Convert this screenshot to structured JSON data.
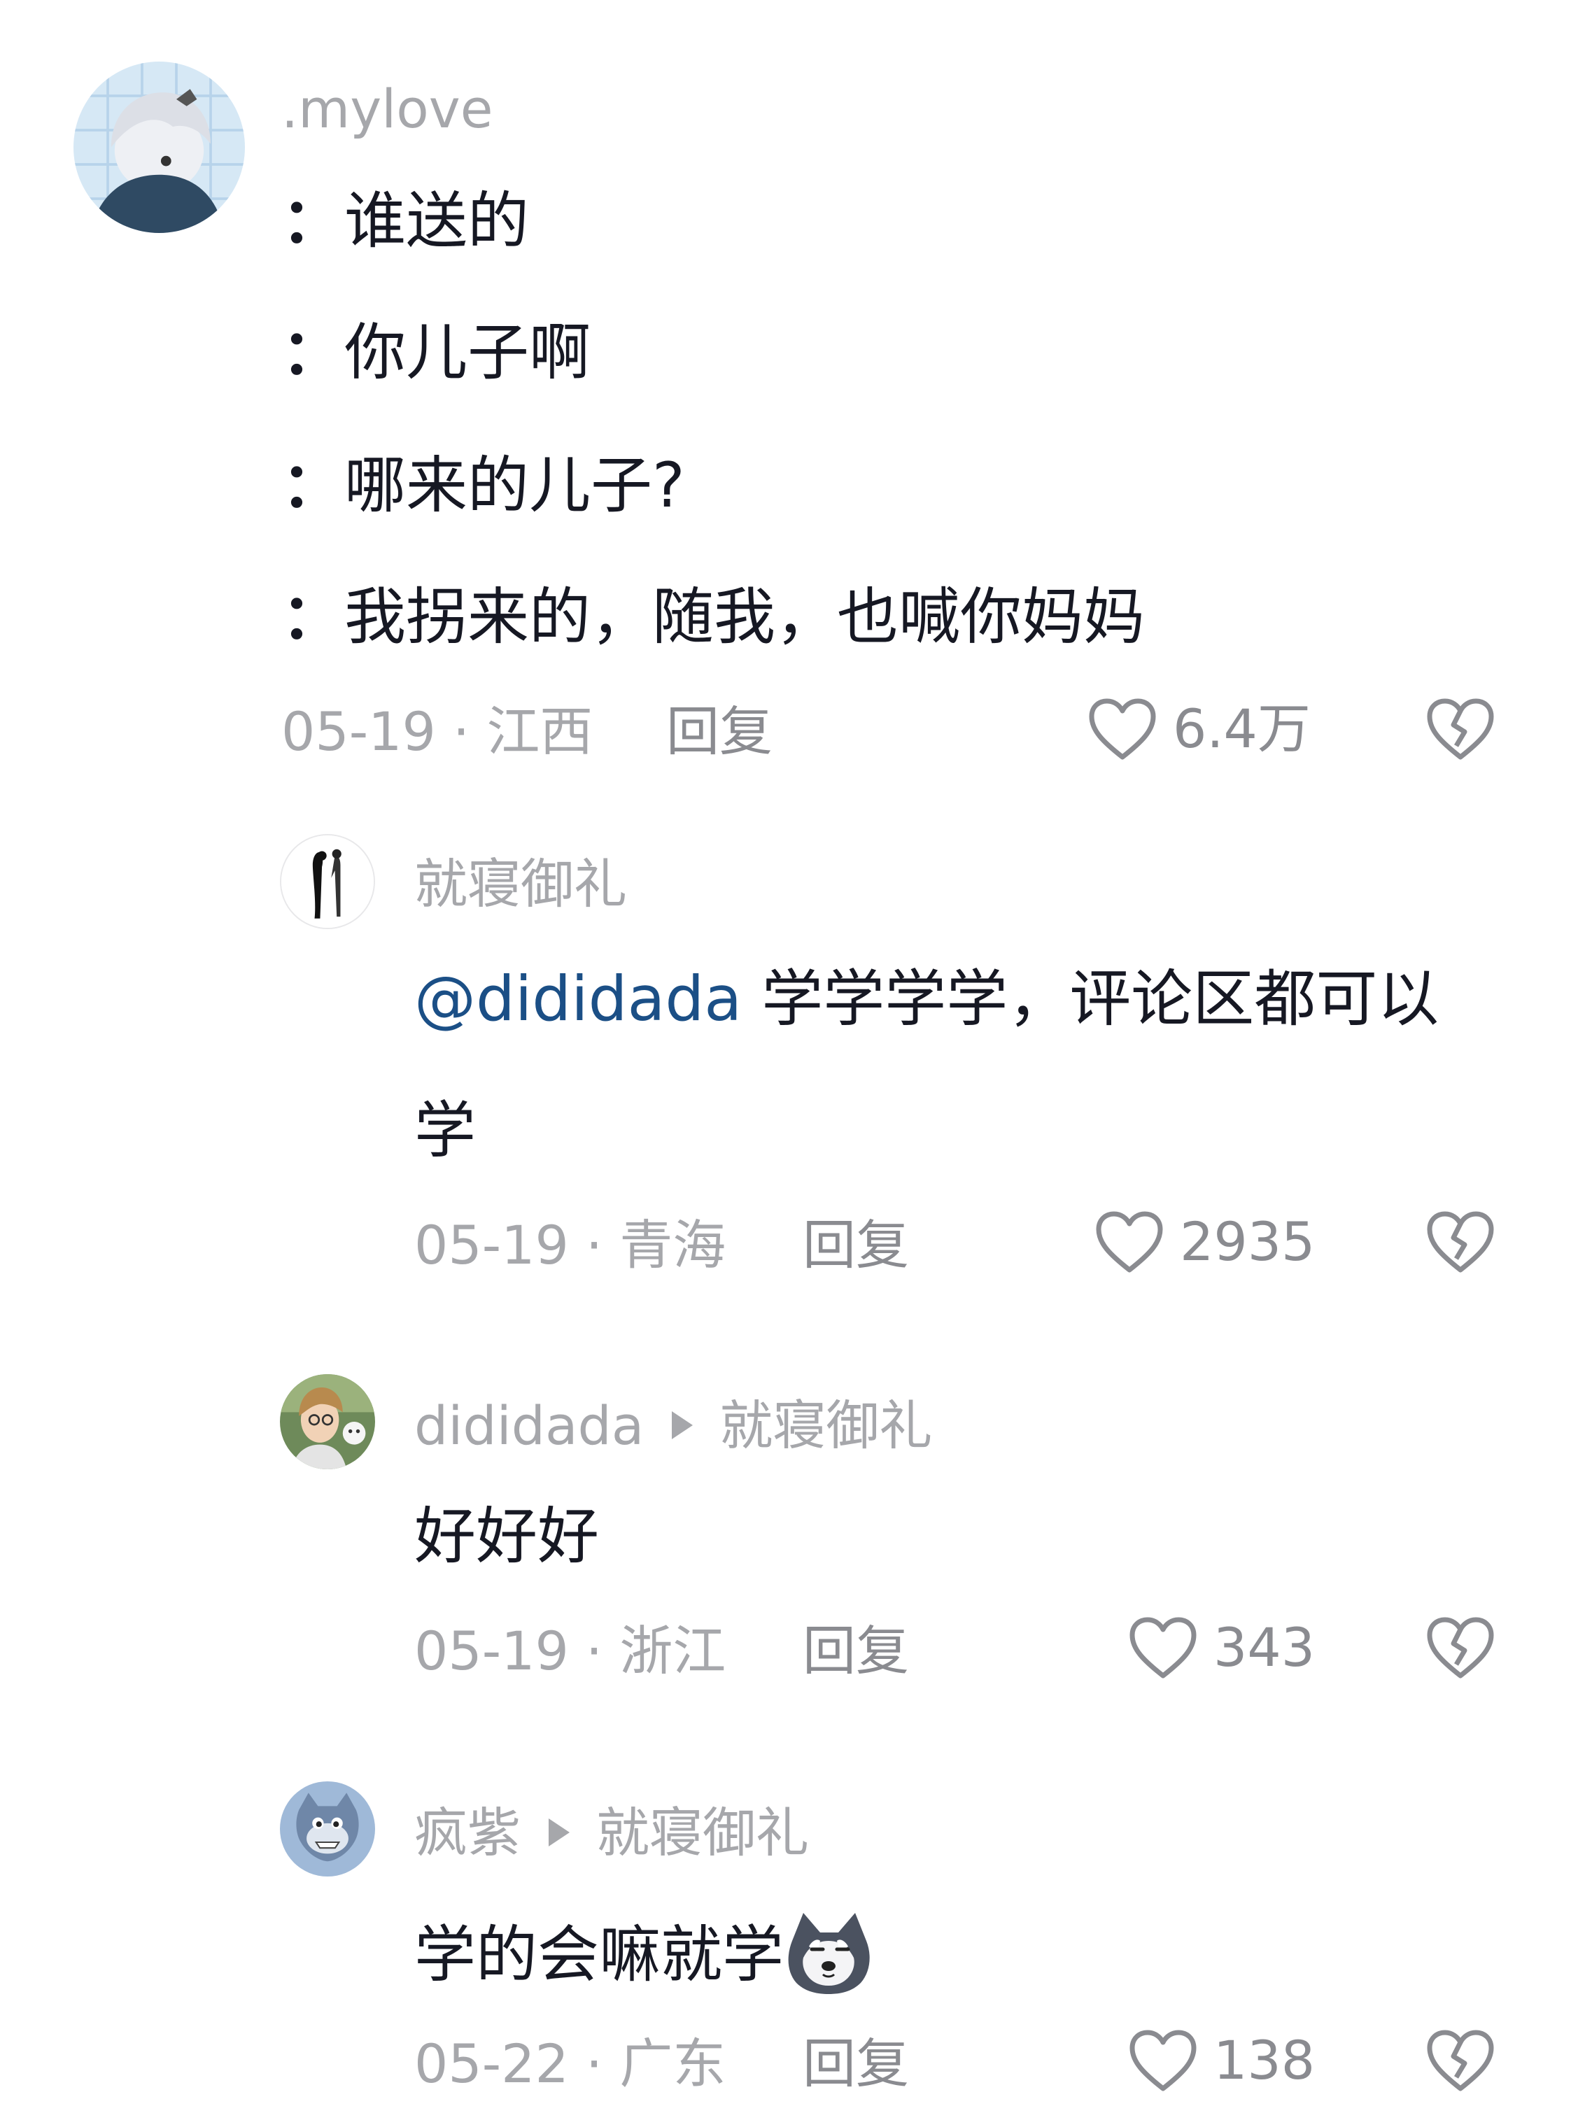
{
  "colors": {
    "text": "#161823",
    "meta": "#a6a7ab",
    "mention": "#1b4f86",
    "background": "#ffffff"
  },
  "comments": [
    {
      "username": ".mylove",
      "lines": [
        "谁送的",
        "你儿子啊",
        "哪来的儿子?",
        "我拐来的，随我，也喊你妈妈"
      ],
      "line_prefix": "：",
      "date_location": "05-19 · 江西",
      "reply_label": "回复",
      "likes": "6.4万"
    },
    {
      "username": "就寝御礼",
      "mention": "@dididada",
      "text_line1": "学学学学，评论区都可以",
      "text_line2": "学",
      "date_location": "05-19 · 青海",
      "reply_label": "回复",
      "likes": "2935"
    },
    {
      "username": "dididada",
      "reply_to": "就寝御礼",
      "text": "好好好",
      "date_location": "05-19 · 浙江",
      "reply_label": "回复",
      "likes": "343"
    },
    {
      "username": "疯紫",
      "reply_to": "就寝御礼",
      "text": "学的会嘛就学",
      "emoji": "husky-emoji",
      "date_location": "05-22 · 广东",
      "reply_label": "回复",
      "likes": "138"
    }
  ],
  "icons": {
    "like": "heart-outline-icon",
    "dislike": "broken-heart-icon"
  }
}
